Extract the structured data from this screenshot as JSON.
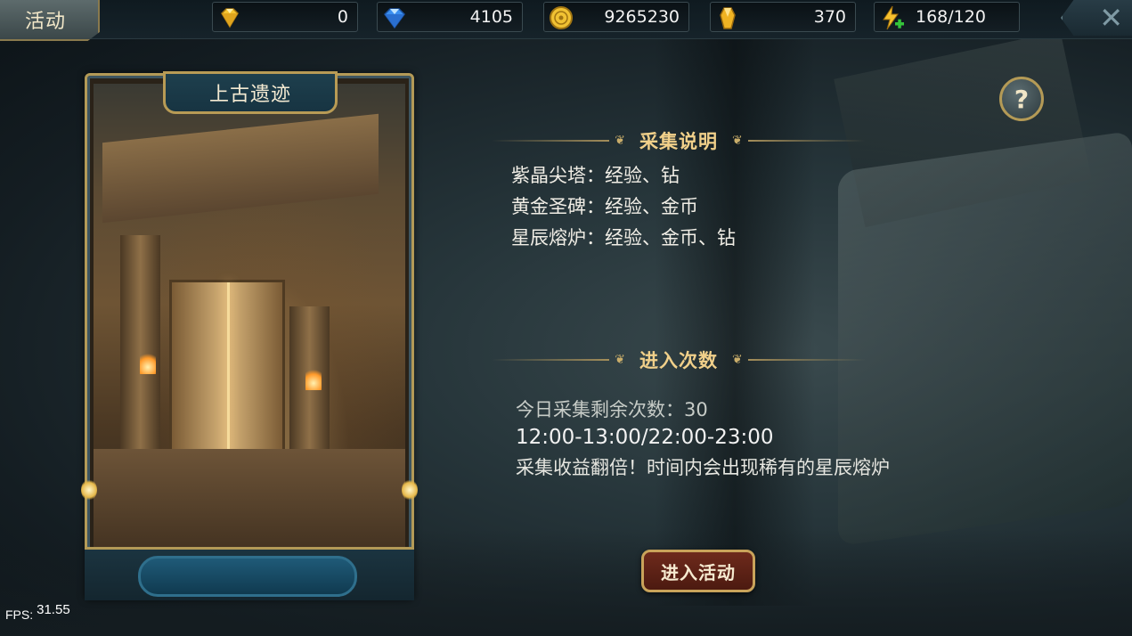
{
  "topbar": {
    "activity_tab": "活动",
    "resources": [
      {
        "name": "gold-gem",
        "icon": "yellow-diamond-icon",
        "value": "0"
      },
      {
        "name": "blue-diamond",
        "icon": "blue-diamond-icon",
        "value": "4105"
      },
      {
        "name": "gold-coin",
        "icon": "gold-coin-icon",
        "value": "9265230"
      },
      {
        "name": "crystal",
        "icon": "gold-crystal-icon",
        "value": "370"
      },
      {
        "name": "stamina",
        "icon": "lightning-plus-icon",
        "value": "168/120"
      }
    ],
    "close_icon": "close-icon"
  },
  "card": {
    "title": "上古遗迹",
    "footer_text": ""
  },
  "help_label": "?",
  "collect_section": {
    "heading": "采集说明",
    "lines": [
      "紫晶尖塔：经验、钻",
      "黄金圣碑：经验、金币",
      "星辰熔炉：经验、金币、钻"
    ]
  },
  "entry_section": {
    "heading": "进入次数",
    "remaining": "今日采集剩余次数：30",
    "time": "12:00-13:00/22:00-23:00",
    "note": "采集收益翻倍！时间内会出现稀有的星辰熔炉"
  },
  "enter_button": "进入活动",
  "fps": {
    "label": "FPS:",
    "value": "31.55"
  },
  "colors": {
    "accent_gold": "#b39a57",
    "heading_gold": "#f1d08a",
    "button_red": "#6e2a1c"
  }
}
